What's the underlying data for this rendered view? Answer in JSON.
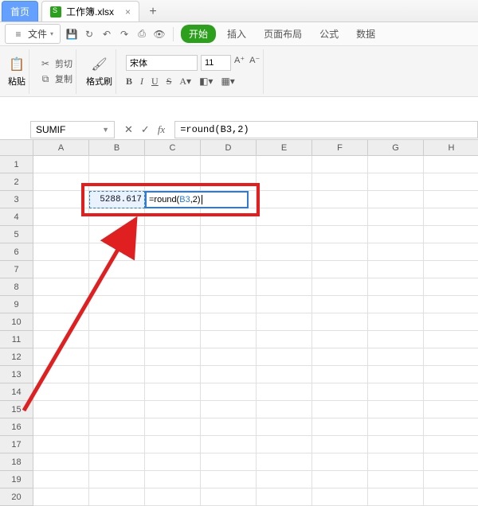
{
  "tabs": {
    "home": "首页",
    "file_name": "工作簿.xlsx"
  },
  "menu": {
    "file": "文件",
    "start_pill": "开始",
    "insert": "插入",
    "page_layout": "页面布局",
    "formulas": "公式",
    "data": "数据"
  },
  "ribbon": {
    "paste_label": "粘贴",
    "cut": "剪切",
    "copy": "复制",
    "format_painter_label": "格式刷",
    "font_name": "宋体",
    "font_size": "11"
  },
  "formula_bar": {
    "name_box": "SUMIF",
    "formula": "=round(B3,2)"
  },
  "grid": {
    "columns": [
      "A",
      "B",
      "C",
      "D",
      "E",
      "F",
      "G",
      "H"
    ],
    "row_count": 20,
    "b3_value": "5288.617",
    "c3_editing": "=round(B3,2)"
  },
  "colors": {
    "highlight_red": "#e02020",
    "selection_blue": "#2d7bd6",
    "start_green": "#2ca01c"
  }
}
